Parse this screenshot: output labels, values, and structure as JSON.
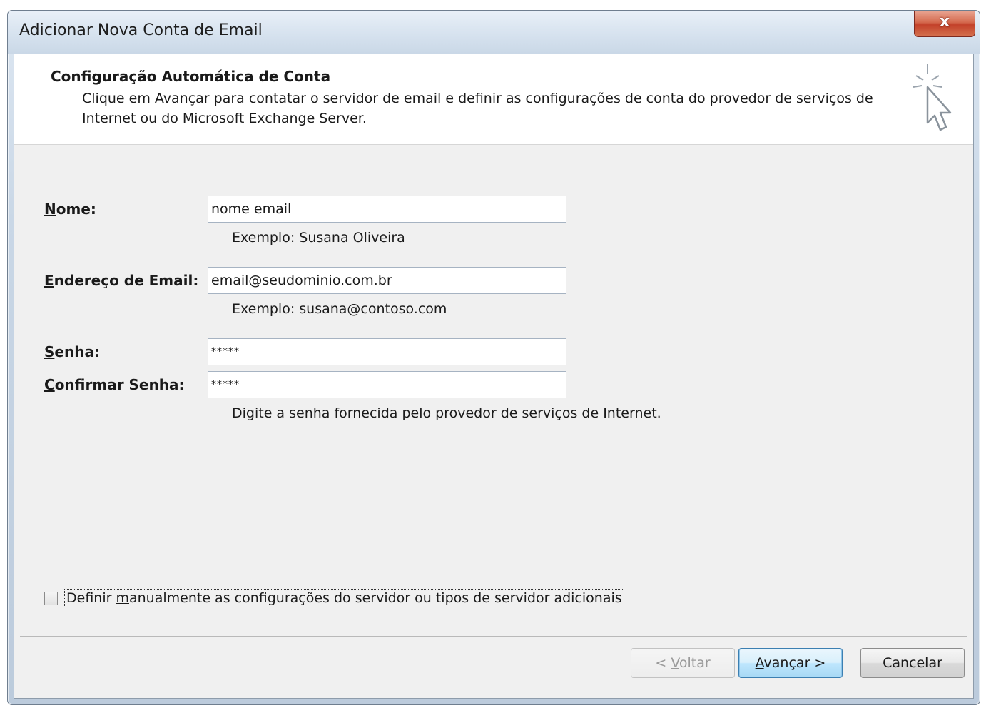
{
  "window": {
    "title": "Adicionar Nova Conta de Email",
    "close_glyph": "x"
  },
  "header": {
    "title": "Configuração Automática de Conta",
    "description": "Clique em Avançar para contatar o servidor de email e definir as configurações de conta do provedor de serviços de Internet ou do Microsoft Exchange Server.",
    "icon": "wizard-cursor-icon"
  },
  "form": {
    "nome": {
      "label_accel": "N",
      "label_rest": "ome:",
      "value": "nome email",
      "hint": "Exemplo: Susana Oliveira"
    },
    "email": {
      "label_accel": "E",
      "label_rest": "ndereço de Email:",
      "value": "email@seudominio.com.br",
      "hint": "Exemplo: susana@contoso.com"
    },
    "senha": {
      "label_accel": "S",
      "label_rest": "enha:",
      "value": "*****"
    },
    "confirmar": {
      "label_accel": "C",
      "label_rest": "onfirmar Senha:",
      "value": "*****"
    },
    "password_hint": "Digite a senha fornecida pelo provedor de serviços de Internet."
  },
  "manual_config": {
    "checked": false,
    "label_pre": "Definir ",
    "label_accel": "m",
    "label_rest": "anualmente as configurações do servidor ou tipos de servidor adicionais"
  },
  "buttons": {
    "back_pre": "< ",
    "back_accel": "V",
    "back_rest": "oltar",
    "next_accel": "A",
    "next_rest": "vançar >",
    "cancel": "Cancelar"
  }
}
